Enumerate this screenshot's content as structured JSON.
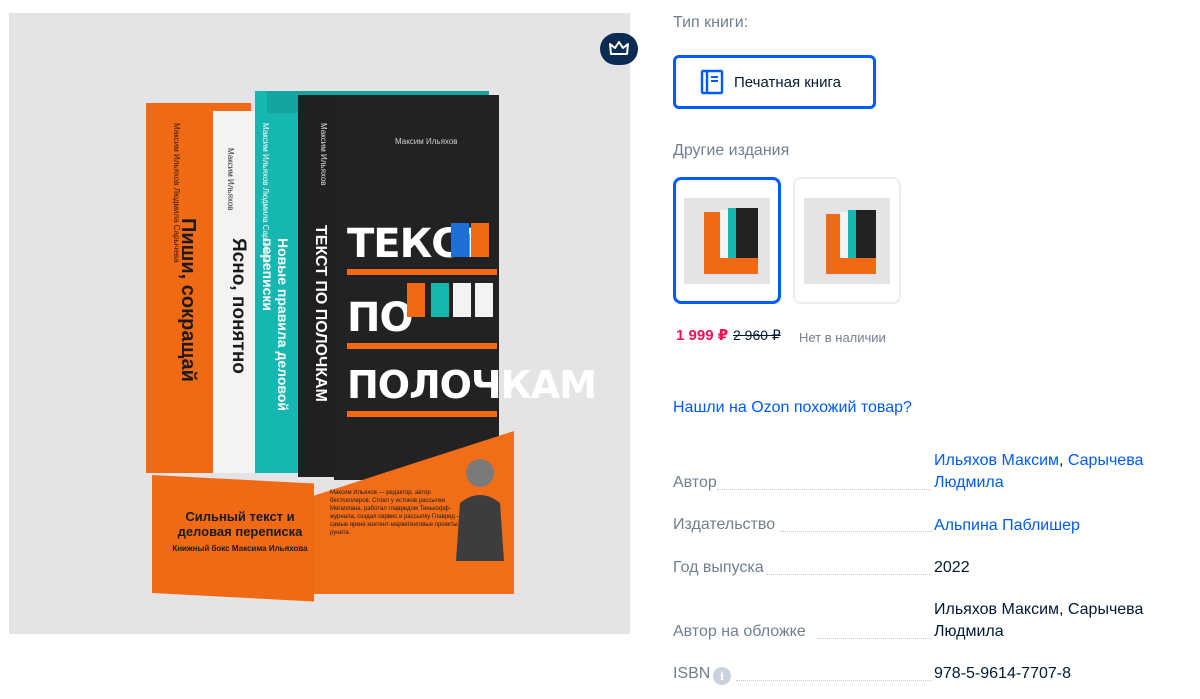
{
  "product": {
    "box_tag_title": "Сильный текст и деловая переписка",
    "box_tag_subtitle": "Книжный бокс Максима Ильяхова",
    "box_bio": "Максим Ильяхов — редактор, автор бестселлеров. Стоял у истоков рассылки Мегаплана, работал главредом Тинькофф-журнала, создал сервис и рассылку Главред — самые яркие контент-маркетинговые проекты рунета.",
    "cover_author": "Максим Ильяхов",
    "cover_title_lines": [
      "ТЕКСТ",
      "ПО",
      "ПОЛОЧКАМ"
    ],
    "spines": {
      "orange_title": "Пиши, сокращай",
      "orange_authors": "Максим Ильяхов Людмила Сарычева",
      "white_title": "Ясно, понятно",
      "white_author": "Максим Ильяхов",
      "teal_title": "Новые правила деловой переписки",
      "teal_authors": "Максим Ильяхов Людмила Сарычева",
      "black_title": "ТЕКСТ ПО ПОЛОЧКАМ",
      "black_author": "Максим Ильяхов"
    },
    "badge_icon": "crown-icon"
  },
  "book_type": {
    "label": "Тип книги:",
    "option_label": "Печатная книга",
    "option_icon": "book-icon"
  },
  "editions": {
    "label": "Другие издания",
    "price": "1 999 ₽",
    "old_price": "2 960 ₽",
    "stock_status": "Нет в наличии"
  },
  "similar_link": "Нашли на Ozon похожий товар?",
  "specs": [
    {
      "label": "Автор",
      "value_parts": [
        "Ильяхов Максим",
        ", ",
        "Сарычева Людмила"
      ]
    },
    {
      "label": "Издательство",
      "value": "Альпина Паблишер"
    },
    {
      "label": "Год выпуска",
      "value": "2022"
    },
    {
      "label": "Автор на обложке",
      "value": "Ильяхов Максим, Сарычева Людмила"
    },
    {
      "label": "ISBN",
      "value": "978-5-9614-7707-8"
    }
  ],
  "colors": {
    "accent": "#005bff",
    "price": "#f91155",
    "muted": "#707f8d",
    "book_orange": "#f06a15",
    "book_teal": "#17b7b1"
  }
}
